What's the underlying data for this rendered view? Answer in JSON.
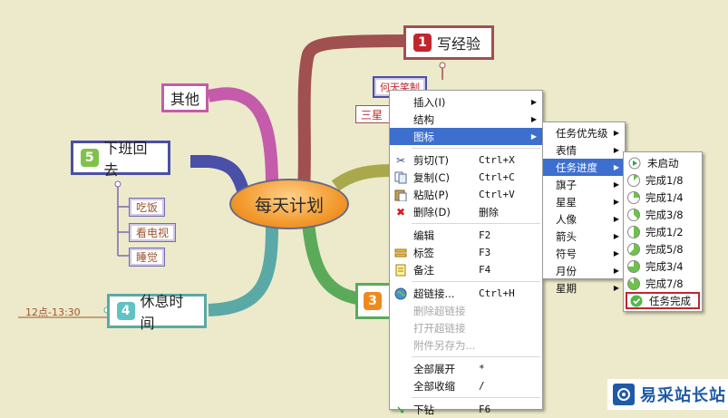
{
  "mindmap": {
    "central": "每天计划",
    "topic1": {
      "num": "1",
      "label": "写经验"
    },
    "topic1_sub_a": "何天笑制",
    "topic1_sub_b": "三星",
    "topic_other": "其他",
    "topic5": {
      "num": "5",
      "label": "下班回去",
      "subs": [
        "吃饭",
        "看电视",
        "睡觉"
      ]
    },
    "topic4": {
      "num": "4",
      "label": "休息时间",
      "note": "12点-13:30"
    },
    "topic3": {
      "num": "3"
    }
  },
  "context_menu": {
    "items": [
      {
        "label": "插入(I)",
        "submenu": true,
        "icon": ""
      },
      {
        "label": "结构",
        "submenu": true,
        "icon": ""
      },
      {
        "label": "图标",
        "submenu": true,
        "icon": "",
        "highlight": true
      },
      {
        "label": "剪切(T)",
        "shortcut": "Ctrl+X",
        "icon": "scissors-icon"
      },
      {
        "label": "复制(C)",
        "shortcut": "Ctrl+C",
        "icon": "copy-icon"
      },
      {
        "label": "粘贴(P)",
        "shortcut": "Ctrl+V",
        "icon": "paste-icon"
      },
      {
        "label": "删除(D)",
        "shortcut": "删除",
        "icon": "delete-icon"
      },
      {
        "label": "编辑",
        "shortcut": "F2",
        "icon": ""
      },
      {
        "label": "标签",
        "shortcut": "F3",
        "icon": "label-icon"
      },
      {
        "label": "备注",
        "shortcut": "F4",
        "icon": "note-icon"
      },
      {
        "label": "超链接...",
        "shortcut": "Ctrl+H",
        "icon": "globe-icon"
      },
      {
        "label": "删除超链接",
        "disabled": true
      },
      {
        "label": "打开超链接",
        "disabled": true
      },
      {
        "label": "附件另存为...",
        "disabled": true
      },
      {
        "label": "全部展开",
        "shortcut": "*"
      },
      {
        "label": "全部收缩",
        "shortcut": "/"
      },
      {
        "label": "下钻",
        "shortcut": "F6",
        "icon": "drill-down-icon"
      }
    ]
  },
  "icon_submenu": {
    "items": [
      "任务优先级",
      "表情",
      "任务进度",
      "旗子",
      "星星",
      "人像",
      "箭头",
      "符号",
      "月份",
      "星期"
    ],
    "highlight_index": 2
  },
  "progress_submenu": {
    "items": [
      {
        "label": "未启动",
        "fraction": 0
      },
      {
        "label": "完成1/8",
        "fraction": 0.125
      },
      {
        "label": "完成1/4",
        "fraction": 0.25
      },
      {
        "label": "完成3/8",
        "fraction": 0.375
      },
      {
        "label": "完成1/2",
        "fraction": 0.5
      },
      {
        "label": "完成5/8",
        "fraction": 0.625
      },
      {
        "label": "完成3/4",
        "fraction": 0.75
      },
      {
        "label": "完成7/8",
        "fraction": 0.875
      },
      {
        "label": "任务完成",
        "fraction": 1,
        "boxed": true
      }
    ]
  },
  "watermark": {
    "text": "易采站长站"
  },
  "colors": {
    "highlight": "#3d6fcf",
    "central_fill": "#f5a03a",
    "accent_red": "#c0272d"
  }
}
